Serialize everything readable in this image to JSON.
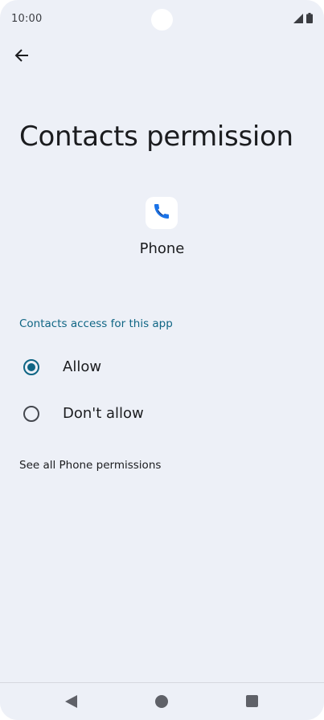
{
  "status_bar": {
    "time": "10:00",
    "icons": [
      "signal-icon",
      "battery-icon"
    ]
  },
  "toolbar": {
    "back_icon": "arrow-left-icon"
  },
  "page": {
    "title": "Contacts permission"
  },
  "app": {
    "icon": "phone-icon",
    "name": "Phone"
  },
  "permission": {
    "section_header": "Contacts access for this app",
    "options": [
      {
        "label": "Allow",
        "selected": true
      },
      {
        "label": "Don't allow",
        "selected": false
      }
    ],
    "see_all_link": "See all Phone permissions"
  },
  "nav_bar": {
    "icons": [
      "nav-back-icon",
      "nav-home-icon",
      "nav-recents-icon"
    ]
  },
  "colors": {
    "background": "#edf0f7",
    "accent": "#0f6584",
    "text": "#1b1c1f",
    "phone_icon": "#1a73e8"
  }
}
